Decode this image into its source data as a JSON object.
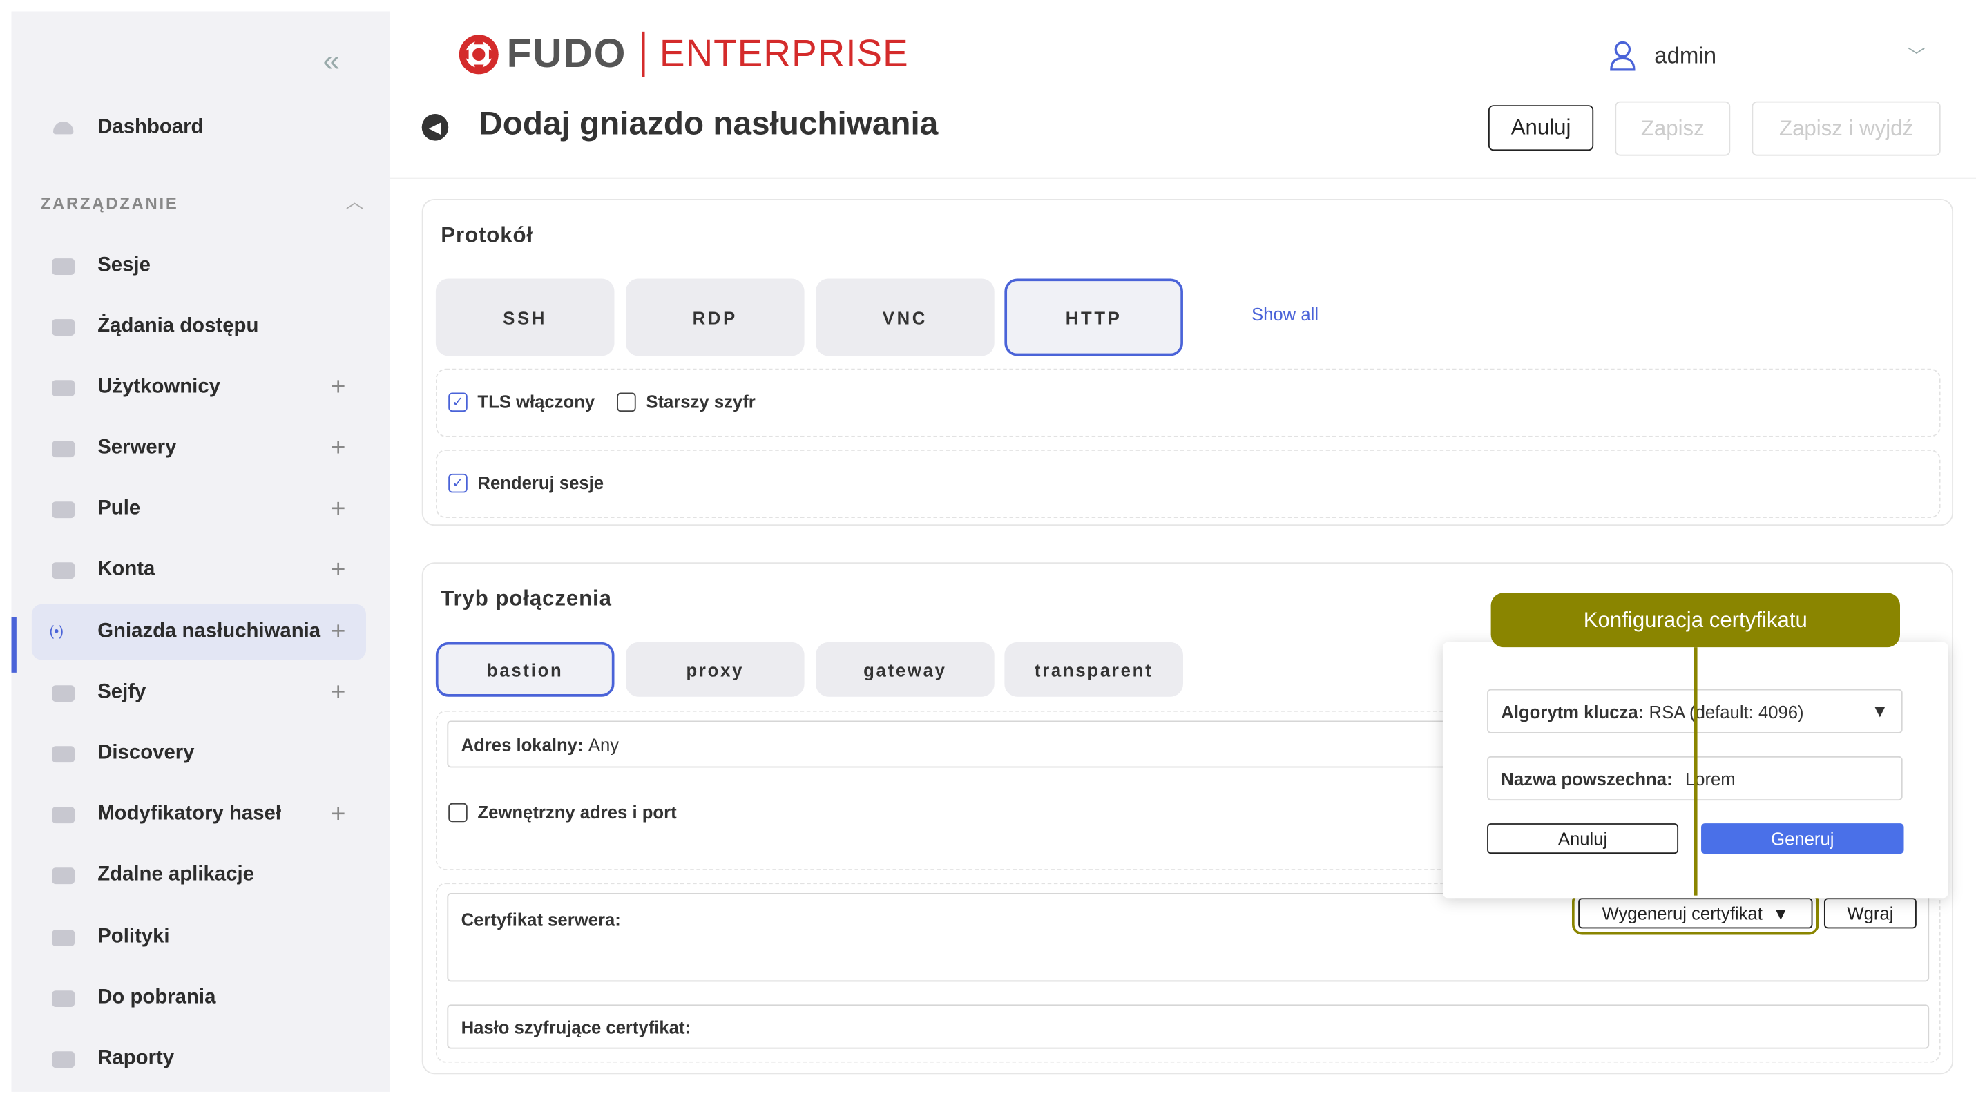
{
  "app": {
    "logo_main": "FUDO",
    "logo_edition": "ENTERPRISE",
    "brand_color": "#d42b2b",
    "accent_color": "#4a63d8",
    "highlight_color": "#8a8500"
  },
  "user": {
    "name": "admin"
  },
  "sidebar": {
    "dashboard": "Dashboard",
    "section": "ZARZĄDZANIE",
    "items": [
      {
        "label": "Sesje",
        "icon": "sessions-icon",
        "plus": false
      },
      {
        "label": "Żądania dostępu",
        "icon": "access-requests-icon",
        "plus": false
      },
      {
        "label": "Użytkownicy",
        "icon": "users-icon",
        "plus": true
      },
      {
        "label": "Serwery",
        "icon": "servers-icon",
        "plus": true
      },
      {
        "label": "Pule",
        "icon": "pools-icon",
        "plus": true
      },
      {
        "label": "Konta",
        "icon": "accounts-icon",
        "plus": true
      },
      {
        "label": "Gniazda nasłuchiwania",
        "icon": "listeners-icon",
        "plus": true,
        "active": true
      },
      {
        "label": "Sejfy",
        "icon": "safes-icon",
        "plus": true
      },
      {
        "label": "Discovery",
        "icon": "discovery-icon",
        "plus": false
      },
      {
        "label": "Modyfikatory haseł",
        "icon": "password-changers-icon",
        "plus": true
      },
      {
        "label": "Zdalne aplikacje",
        "icon": "remote-apps-icon",
        "plus": false
      },
      {
        "label": "Polityki",
        "icon": "policies-icon",
        "plus": false
      },
      {
        "label": "Do pobrania",
        "icon": "downloads-icon",
        "plus": false
      },
      {
        "label": "Raporty",
        "icon": "reports-icon",
        "plus": false
      }
    ]
  },
  "header": {
    "title": "Dodaj gniazdo nasłuchiwania",
    "cancel": "Anuluj",
    "save": "Zapisz",
    "save_exit": "Zapisz i wyjdź"
  },
  "protocol": {
    "title": "Protokół",
    "tabs": [
      "SSH",
      "RDP",
      "VNC",
      "HTTP"
    ],
    "selected": "HTTP",
    "show_all": "Show all",
    "tls": "TLS włączony",
    "legacy": "Starszy szyfr",
    "render": "Renderuj sesje"
  },
  "connection": {
    "title": "Tryb połączenia",
    "tabs": [
      "bastion",
      "proxy",
      "gateway",
      "transparent"
    ],
    "selected": "bastion",
    "local_addr_label": "Adres lokalny:",
    "local_addr_value": "Any",
    "external": "Zewnętrzny adres i port",
    "cert_label": "Certyfikat serwera:",
    "generate": "Wygeneruj certyfikat",
    "upload": "Wgraj",
    "cert_pass_label": "Hasło szyfrujące certyfikat:"
  },
  "popup": {
    "tooltip": "Konfiguracja certyfikatu",
    "algo_label": "Algorytm klucza:",
    "algo_value": "RSA (default: 4096)",
    "cn_label": "Nazwa powszechna:",
    "cn_value": "Lorem",
    "cancel": "Anuluj",
    "generate": "Generuj"
  }
}
